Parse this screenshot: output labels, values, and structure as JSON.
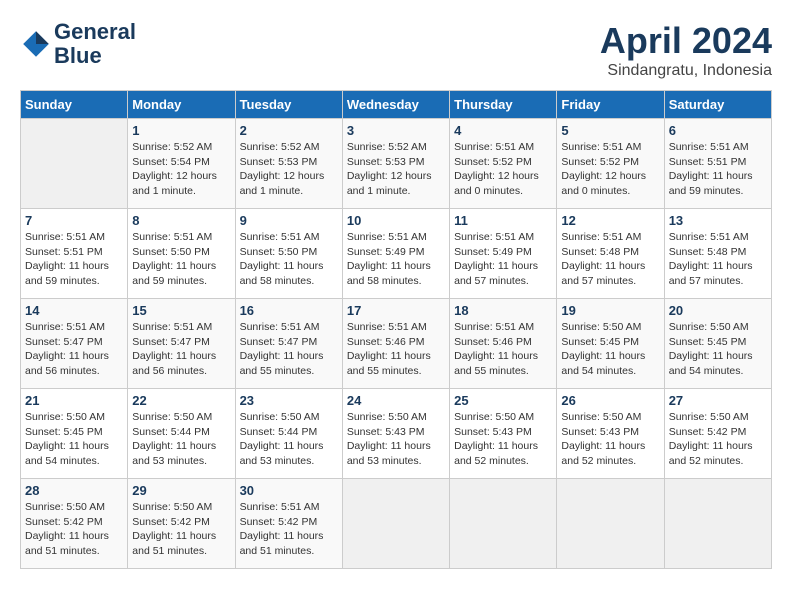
{
  "header": {
    "logo_line1": "General",
    "logo_line2": "Blue",
    "month": "April 2024",
    "location": "Sindangratu, Indonesia"
  },
  "columns": [
    "Sunday",
    "Monday",
    "Tuesday",
    "Wednesday",
    "Thursday",
    "Friday",
    "Saturday"
  ],
  "weeks": [
    [
      {
        "day": "",
        "info": ""
      },
      {
        "day": "1",
        "info": "Sunrise: 5:52 AM\nSunset: 5:54 PM\nDaylight: 12 hours\nand 1 minute."
      },
      {
        "day": "2",
        "info": "Sunrise: 5:52 AM\nSunset: 5:53 PM\nDaylight: 12 hours\nand 1 minute."
      },
      {
        "day": "3",
        "info": "Sunrise: 5:52 AM\nSunset: 5:53 PM\nDaylight: 12 hours\nand 1 minute."
      },
      {
        "day": "4",
        "info": "Sunrise: 5:51 AM\nSunset: 5:52 PM\nDaylight: 12 hours\nand 0 minutes."
      },
      {
        "day": "5",
        "info": "Sunrise: 5:51 AM\nSunset: 5:52 PM\nDaylight: 12 hours\nand 0 minutes."
      },
      {
        "day": "6",
        "info": "Sunrise: 5:51 AM\nSunset: 5:51 PM\nDaylight: 11 hours\nand 59 minutes."
      }
    ],
    [
      {
        "day": "7",
        "info": "Sunrise: 5:51 AM\nSunset: 5:51 PM\nDaylight: 11 hours\nand 59 minutes."
      },
      {
        "day": "8",
        "info": "Sunrise: 5:51 AM\nSunset: 5:50 PM\nDaylight: 11 hours\nand 59 minutes."
      },
      {
        "day": "9",
        "info": "Sunrise: 5:51 AM\nSunset: 5:50 PM\nDaylight: 11 hours\nand 58 minutes."
      },
      {
        "day": "10",
        "info": "Sunrise: 5:51 AM\nSunset: 5:49 PM\nDaylight: 11 hours\nand 58 minutes."
      },
      {
        "day": "11",
        "info": "Sunrise: 5:51 AM\nSunset: 5:49 PM\nDaylight: 11 hours\nand 57 minutes."
      },
      {
        "day": "12",
        "info": "Sunrise: 5:51 AM\nSunset: 5:48 PM\nDaylight: 11 hours\nand 57 minutes."
      },
      {
        "day": "13",
        "info": "Sunrise: 5:51 AM\nSunset: 5:48 PM\nDaylight: 11 hours\nand 57 minutes."
      }
    ],
    [
      {
        "day": "14",
        "info": "Sunrise: 5:51 AM\nSunset: 5:47 PM\nDaylight: 11 hours\nand 56 minutes."
      },
      {
        "day": "15",
        "info": "Sunrise: 5:51 AM\nSunset: 5:47 PM\nDaylight: 11 hours\nand 56 minutes."
      },
      {
        "day": "16",
        "info": "Sunrise: 5:51 AM\nSunset: 5:47 PM\nDaylight: 11 hours\nand 55 minutes."
      },
      {
        "day": "17",
        "info": "Sunrise: 5:51 AM\nSunset: 5:46 PM\nDaylight: 11 hours\nand 55 minutes."
      },
      {
        "day": "18",
        "info": "Sunrise: 5:51 AM\nSunset: 5:46 PM\nDaylight: 11 hours\nand 55 minutes."
      },
      {
        "day": "19",
        "info": "Sunrise: 5:50 AM\nSunset: 5:45 PM\nDaylight: 11 hours\nand 54 minutes."
      },
      {
        "day": "20",
        "info": "Sunrise: 5:50 AM\nSunset: 5:45 PM\nDaylight: 11 hours\nand 54 minutes."
      }
    ],
    [
      {
        "day": "21",
        "info": "Sunrise: 5:50 AM\nSunset: 5:45 PM\nDaylight: 11 hours\nand 54 minutes."
      },
      {
        "day": "22",
        "info": "Sunrise: 5:50 AM\nSunset: 5:44 PM\nDaylight: 11 hours\nand 53 minutes."
      },
      {
        "day": "23",
        "info": "Sunrise: 5:50 AM\nSunset: 5:44 PM\nDaylight: 11 hours\nand 53 minutes."
      },
      {
        "day": "24",
        "info": "Sunrise: 5:50 AM\nSunset: 5:43 PM\nDaylight: 11 hours\nand 53 minutes."
      },
      {
        "day": "25",
        "info": "Sunrise: 5:50 AM\nSunset: 5:43 PM\nDaylight: 11 hours\nand 52 minutes."
      },
      {
        "day": "26",
        "info": "Sunrise: 5:50 AM\nSunset: 5:43 PM\nDaylight: 11 hours\nand 52 minutes."
      },
      {
        "day": "27",
        "info": "Sunrise: 5:50 AM\nSunset: 5:42 PM\nDaylight: 11 hours\nand 52 minutes."
      }
    ],
    [
      {
        "day": "28",
        "info": "Sunrise: 5:50 AM\nSunset: 5:42 PM\nDaylight: 11 hours\nand 51 minutes."
      },
      {
        "day": "29",
        "info": "Sunrise: 5:50 AM\nSunset: 5:42 PM\nDaylight: 11 hours\nand 51 minutes."
      },
      {
        "day": "30",
        "info": "Sunrise: 5:51 AM\nSunset: 5:42 PM\nDaylight: 11 hours\nand 51 minutes."
      },
      {
        "day": "",
        "info": ""
      },
      {
        "day": "",
        "info": ""
      },
      {
        "day": "",
        "info": ""
      },
      {
        "day": "",
        "info": ""
      }
    ]
  ]
}
